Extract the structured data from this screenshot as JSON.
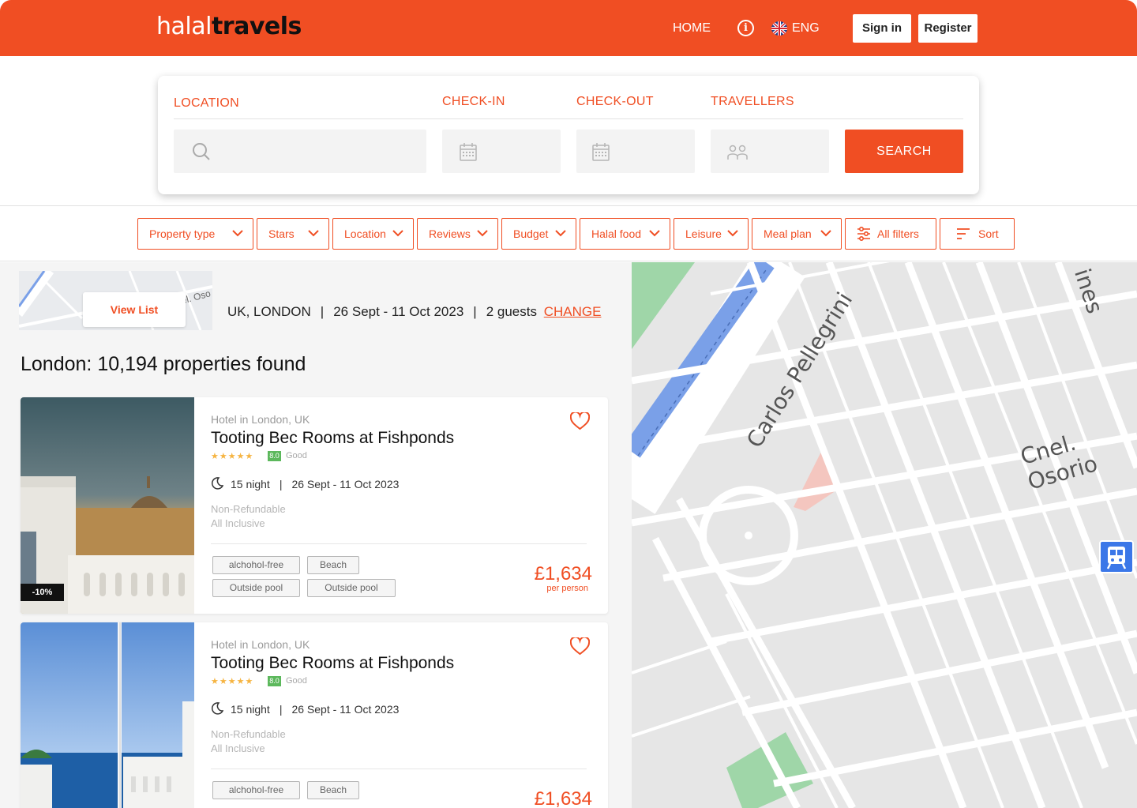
{
  "header": {
    "logo_light": "halal",
    "logo_bold": "travels",
    "nav_home": "HOME",
    "lang": "ENG",
    "signin": "Sign in",
    "register": "Register"
  },
  "search": {
    "location_label": "LOCATION",
    "checkin_label": "CHECK-IN",
    "checkout_label": "CHECK-OUT",
    "travellers_label": "TRAVELLERS",
    "search_button": "SEARCH"
  },
  "filters": [
    "Property type",
    "Stars",
    "Location",
    "Reviews",
    "Budget",
    "Halal food",
    "Leisure",
    "Meal plan",
    "All filters",
    "Sort"
  ],
  "results": {
    "view_list": "View List",
    "mini_map_label": "Cnel. Oso",
    "location": "UK, LONDON",
    "dates": "26 Sept - 11 Oct 2023",
    "guests": "2 guests",
    "change": "CHANGE",
    "title": "London: 10,194 properties found"
  },
  "cards": [
    {
      "type": "Hotel in London, UK",
      "name": "Tooting Bec Rooms at Fishponds",
      "stars": "★★★★★",
      "score": "8.0",
      "rating": "Good",
      "nights": "15 night",
      "dates": "26 Sept - 11 Oct 2023",
      "refund": "Non-Refundable",
      "board": "All Inclusive",
      "tags": [
        "alchohol-free",
        "Beach",
        "Outside pool",
        "Outside pool"
      ],
      "price": "£1,634",
      "per": "per person",
      "discount": "-10%"
    },
    {
      "type": "Hotel in London, UK",
      "name": "Tooting Bec Rooms at Fishponds",
      "stars": "★★★★★",
      "score": "8.0",
      "rating": "Good",
      "nights": "15 night",
      "dates": "26 Sept - 11 Oct 2023",
      "refund": "Non-Refundable",
      "board": "All Inclusive",
      "tags": [
        "alchohol-free",
        "Beach",
        "",
        ""
      ],
      "price": "£1,634",
      "per": "",
      "discount": ""
    }
  ],
  "map": {
    "street1": "Carlos Pellegrini",
    "street2": "Cnel. Osorio",
    "street3": "ines"
  },
  "colors": {
    "accent": "#f04e23",
    "score_green": "#5cb85c",
    "star": "#f6b441"
  }
}
